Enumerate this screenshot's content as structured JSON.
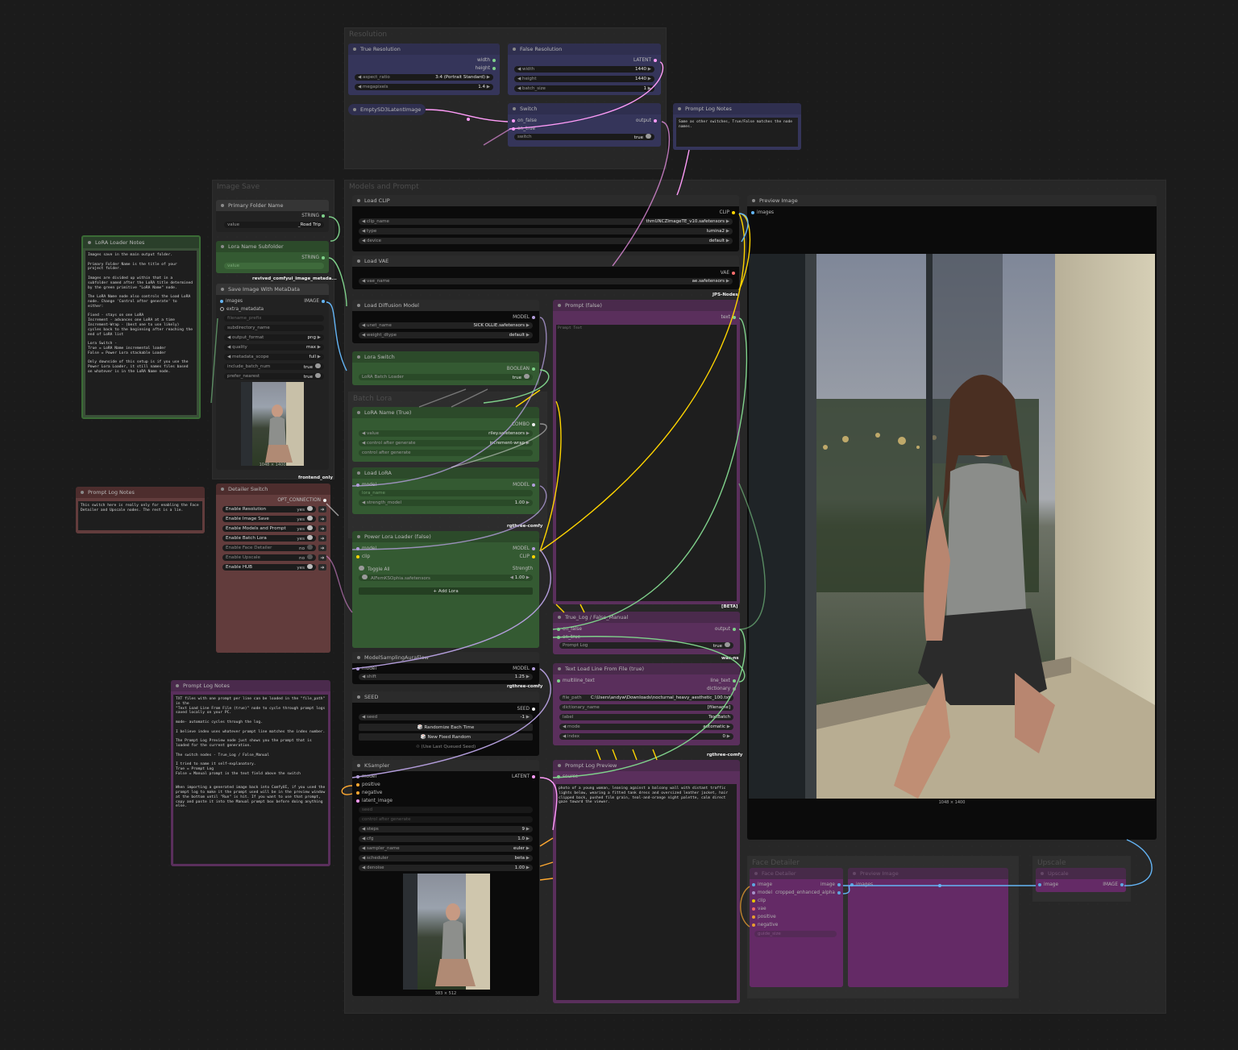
{
  "groups": {
    "resolution": "Resolution",
    "image_save": "Image Save",
    "models_prompt": "Models and Prompt",
    "batch_lora": "Batch Lora",
    "face_detailer": "Face Detailer",
    "upscale": "Upscale"
  },
  "true_res": {
    "title": "True Resolution",
    "out_width": "width",
    "out_height": "height",
    "aspect_label": "aspect_ratio",
    "aspect_value": "3:4 (Portrait Standard)",
    "mp_label": "megapixels",
    "mp_value": "1.4"
  },
  "false_res": {
    "title": "False Resolution",
    "out": "LATENT",
    "width_label": "width",
    "width_value": "1440",
    "height_label": "height",
    "height_value": "1440",
    "batch_label": "batch_size",
    "batch_value": "1"
  },
  "empty_latent": {
    "title": "EmptySD3LatentImage"
  },
  "switch": {
    "title": "Switch",
    "on_false": "on_false",
    "on_true": "on_true",
    "output": "output",
    "switch_label": "switch",
    "switch_value": "true"
  },
  "prompt_log_notes_top": {
    "title": "Prompt Log Notes",
    "text": "Same as other switches, True/False matches the node names."
  },
  "primary_folder": {
    "title": "Primary Folder Name",
    "out": "STRING",
    "value_label": "value",
    "value": "_Road Trip"
  },
  "lora_subfolder": {
    "title": "Lora Name Subfolder",
    "out": "STRING",
    "value_label": "value"
  },
  "save_image": {
    "title": "Save Image With MetaData",
    "in_images": "images",
    "in_extra": "extra_metadata",
    "in_filename": "filename_prefix",
    "out": "IMAGE",
    "badge": "revived_comfyui_image_metada...",
    "subdir_label": "subdirectory_name",
    "format_label": "output_format",
    "format_value": "png",
    "quality_label": "quality",
    "quality_value": "max",
    "scope_label": "metadata_scope",
    "scope_value": "full",
    "batch_label": "include_batch_num",
    "batch_value": "true",
    "nearest_label": "prefer_nearest",
    "nearest_value": "true",
    "size": "1048 × 1400",
    "badge2": "frontend_only"
  },
  "lora_notes": {
    "title": "LoRA Loader Notes",
    "text": "Images save in the main output folder.\n\nPrimary Folder Name is the title of your project folder.\n\nImages are divided up within that in a subfolder named after the LoRA title determined by the green primitive \"LoRA Name\" node.\n\nThe LoRA Name node also controls the Load LoRA node. Change 'Control after generate' to either:\n\nFixed - stays on one LoRA\nIncrement - advances one LoRA at a time\nIncrement-Wrap - (best one to use likely) cycles back to the beginning after reaching the end of LoRA list\n\nLora Switch -\nTrue = LoRA Name incremental loader\nFalse = Power Lora stackable Loader\n\nOnly downside of this setup is if you use the Power Lora Loader, it still names files based on whatever is in the LoRA Name node."
  },
  "prompt_notes_mid": {
    "title": "Prompt Log Notes",
    "text": "This switch here is really only for enabling the Face Detailer and Upscale nodes. The rest is a lie."
  },
  "detailer_switch": {
    "title": "Detailer Switch",
    "out": "OPT_CONNECTION",
    "rows": [
      {
        "label": "Enable Resolution",
        "value": "yes"
      },
      {
        "label": "Enable Image Save",
        "value": "yes"
      },
      {
        "label": "Enable Models and Prompt",
        "value": "yes"
      },
      {
        "label": "Enable Batch Lora",
        "value": "yes"
      },
      {
        "label": "Enable Face Detailer",
        "value": "no"
      },
      {
        "label": "Enable Upscale",
        "value": "no"
      },
      {
        "label": "Enable HUB",
        "value": "yes"
      }
    ]
  },
  "prompt_notes_low": {
    "title": "Prompt Log Notes",
    "text": "TXT files with one prompt per line can be loaded in the \"file_path\" in the\n\"Text Load Line From File (true)\" node to cycle through prompt logs saved locally on your PC.\n\nmode- automatic cycles through the log.\n\nI believe index uses whatever prompt line matches the index number.\n\nThe Prompt Log Preview node just shows you the prompt that is loaded for the current generation.\n\nThe switch nodes - True_Log / False_Manual\n\nI tried to name it self-explanatory.\nTrue = Prompt Log\nFalse = Manual prompt in the text field above the switch\n\n\nWhen importing a generated image back into ComfyUI, if you used the prompt log to make it the prompt used will be in the preview window at the bottom until \"Run\" is hit. If you want to use that prompt, copy and paste it into the Manual prompt box before doing anything else."
  },
  "load_clip": {
    "title": "Load CLIP",
    "out": "CLIP",
    "name_label": "clip_name",
    "name_value": "thmUNCZImageTE_v10.safetensors",
    "type_label": "type",
    "type_value": "lumina2",
    "device_label": "device",
    "device_value": "default"
  },
  "load_vae": {
    "title": "Load VAE",
    "out": "VAE",
    "name_label": "vae_name",
    "name_value": "ae.safetensors",
    "badge": "JPS-Nodes"
  },
  "diffusion": {
    "title": "Load Diffusion Model",
    "out": "MODEL",
    "unet_label": "unet_name",
    "unet_value": "SICK OLLIE.safetensors",
    "dtype_label": "weight_dtype",
    "dtype_value": "default"
  },
  "lora_switch": {
    "title": "Lora Switch",
    "out": "BOOLEAN",
    "label": "LoRA Batch Loader",
    "value": "true"
  },
  "lora_name": {
    "title": "LoRA Name (True)",
    "out": "COMBO",
    "value_label": "value",
    "value": "riley.safetensors",
    "ctrl_label": "control after generate",
    "ctrl_value": "increment-wrap",
    "ctrl2_label": "control after generate"
  },
  "load_lora": {
    "title": "Load LoRA",
    "in_model": "model",
    "out": "MODEL",
    "name_label": "lora_name",
    "strength_label": "strength_model",
    "strength_value": "1.00",
    "badge": "rgthree-comfy"
  },
  "power_lora": {
    "title": "Power Lora Loader (false)",
    "in_model": "model",
    "in_clip": "clip",
    "out_model": "MODEL",
    "out_clip": "CLIP",
    "toggle": "Toggle All",
    "strength": "Strength",
    "lora_file": "AlFemKSOphia.safetensors",
    "lora_strength": "1.00",
    "add": "+ Add Lora"
  },
  "aura": {
    "title": "ModelSamplingAuraFlow",
    "in_model": "model",
    "out": "MODEL",
    "shift_label": "shift",
    "shift_value": "1.25",
    "badge": "rgthree-comfy"
  },
  "seed": {
    "title": "SEED",
    "out": "SEED",
    "seed_label": "seed",
    "seed_value": "-1",
    "btn1": "🎲 Randomize Each Time",
    "btn2": "🎲 New Fixed Random",
    "btn3": "♲ (Use Last Queued Seed)"
  },
  "ksampler": {
    "title": "KSampler",
    "in": [
      "model",
      "positive",
      "negative",
      "latent_image"
    ],
    "out": "LATENT",
    "seed_label": "seed",
    "ctrl_label": "control after generate",
    "steps_label": "steps",
    "steps_value": "9",
    "cfg_label": "cfg",
    "cfg_value": "1.0",
    "sampler_label": "sampler_name",
    "sampler_value": "euler",
    "sched_label": "scheduler",
    "sched_value": "beta",
    "denoise_label": "denoise",
    "denoise_value": "1.00",
    "size": "383 × 512"
  },
  "prompt_false": {
    "title": "Prompt (false)",
    "out": "text",
    "placeholder": "Prompt Text",
    "badge": "[BETA]"
  },
  "true_log": {
    "title": "True_Log / False_Manual",
    "on_false": "on_false",
    "on_true": "on_true",
    "output": "output",
    "label": "Prompt Log",
    "value": "true",
    "badge": "was-ns"
  },
  "text_load": {
    "title": "Text Load Line From File (true)",
    "in_multi": "multiline_text",
    "out_line": "line_text",
    "out_dict": "dictionary",
    "path_label": "file_path",
    "path_value": "C:\\Users\\andyw\\Downloads\\nocturnal_heavy_aesthetic_100.txt",
    "dict_label": "dictionary_name",
    "dict_value": "[filename]",
    "label_label": "label",
    "label_value": "TextBatch",
    "mode_label": "mode",
    "mode_value": "automatic",
    "index_label": "index",
    "index_value": "0",
    "badge": "rgthree-comfy"
  },
  "prompt_preview": {
    "title": "Prompt Log Preview",
    "in": "source",
    "text": "photo of a young woman, leaning against a balcony wall with distant traffic lights below, wearing a fitted tank dress and oversized leather jacket, hair clipped back, pushed film grain, teal-and-orange night palette, calm direct gaze toward the viewer."
  },
  "preview": {
    "title": "Preview Image",
    "in": "images",
    "size": "1048 × 1400"
  },
  "face_detailer": {
    "title": "Face Detailer",
    "in": [
      "image",
      "model",
      "clip",
      "vae",
      "positive",
      "negative"
    ],
    "out_image": "image",
    "out_crop": "cropped_enhanced_alpha",
    "widget": "guide_size"
  },
  "face_preview": {
    "title": "Preview Image",
    "in": "images"
  },
  "upscale": {
    "title": "Upscale",
    "in": "image",
    "out": "IMAGE"
  },
  "colors": {
    "blue": "#35355a",
    "green": "#345a32",
    "purple": "#5a2f5c",
    "red": "#623c3c"
  }
}
